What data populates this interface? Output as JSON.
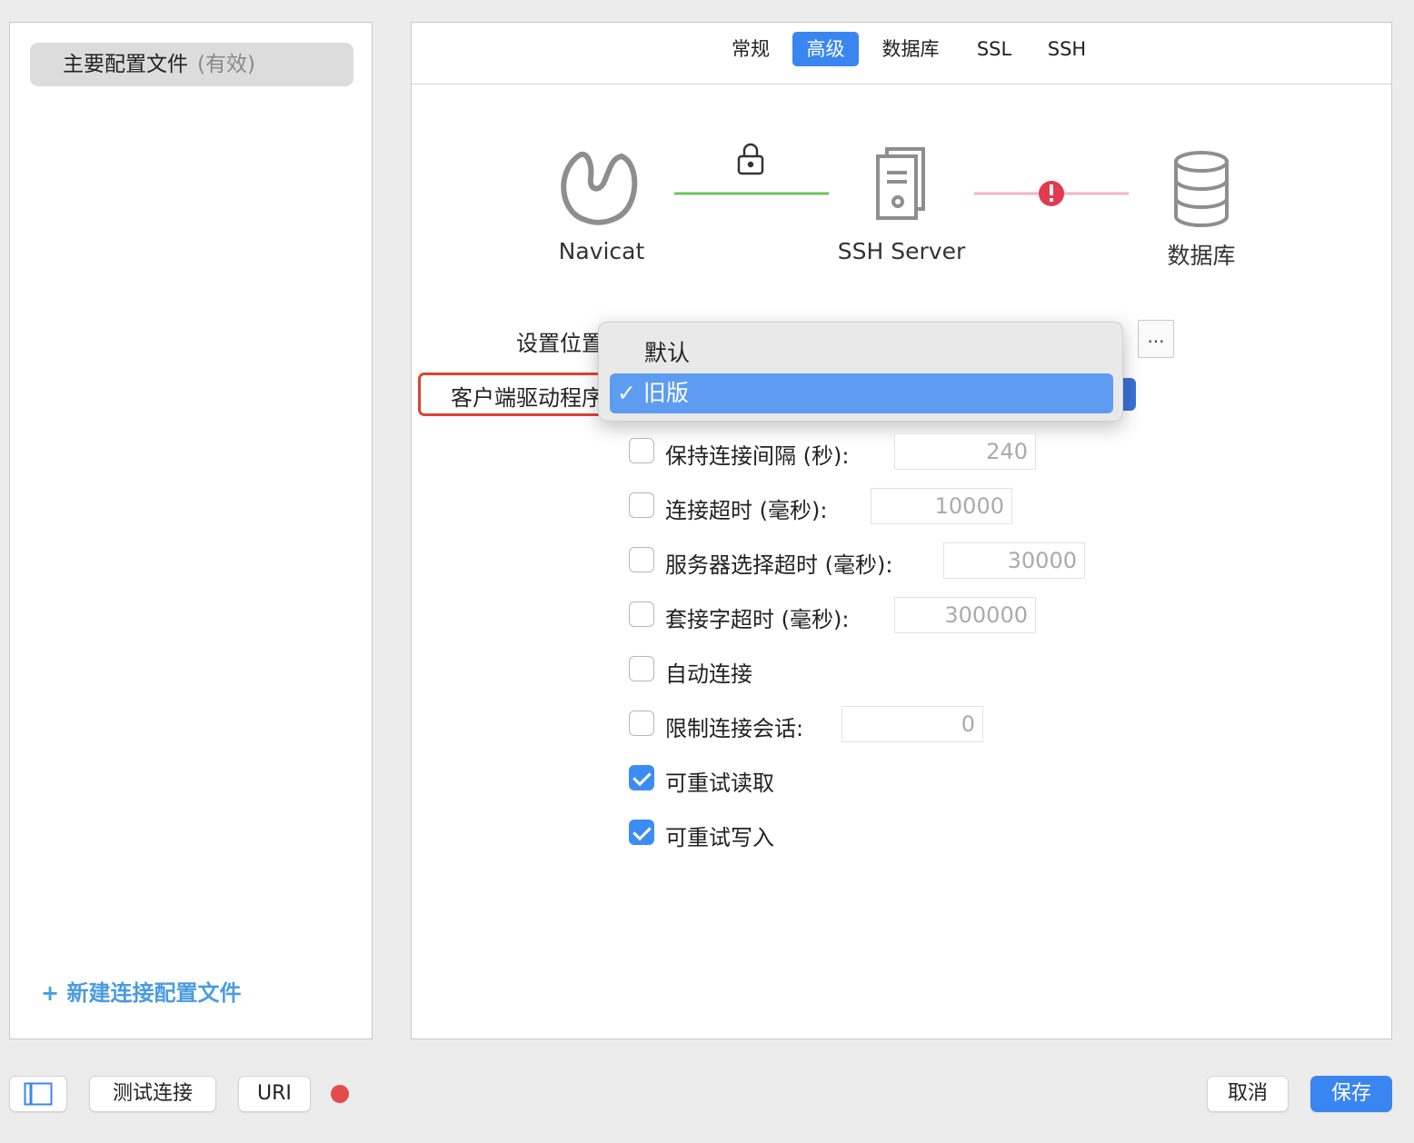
{
  "sidebar": {
    "profile_name": "主要配置文件",
    "profile_state": "(有效)",
    "new_profile": "+ 新建连接配置文件"
  },
  "tabs": [
    {
      "label": "常规",
      "active": false
    },
    {
      "label": "高级",
      "active": true
    },
    {
      "label": "数据库",
      "active": false
    },
    {
      "label": "SSL",
      "active": false
    },
    {
      "label": "SSH",
      "active": false
    }
  ],
  "diagram": {
    "nodes": [
      "Navicat",
      "SSH Server",
      "数据库"
    ],
    "link1_color": "#6cc35a",
    "link2_color": "#f0b5c4",
    "error_color": "#e23a4f"
  },
  "form": {
    "settings_location_label": "设置位置",
    "client_driver_label": "客户端驱动程序",
    "browse_button": "...",
    "dropdown_options": [
      "默认",
      "旧版"
    ],
    "dropdown_selected": "旧版",
    "options": [
      {
        "label": "保持连接间隔 (秒):",
        "checked": false,
        "value": "240"
      },
      {
        "label": "连接超时 (毫秒):",
        "checked": false,
        "value": "10000"
      },
      {
        "label": "服务器选择超时 (毫秒):",
        "checked": false,
        "value": "30000"
      },
      {
        "label": "套接字超时 (毫秒):",
        "checked": false,
        "value": "300000"
      },
      {
        "label": "自动连接",
        "checked": false
      },
      {
        "label": "限制连接会话:",
        "checked": false,
        "value": "0"
      },
      {
        "label": "可重试读取",
        "checked": true
      },
      {
        "label": "可重试写入",
        "checked": true
      }
    ]
  },
  "footer": {
    "test_connection": "测试连接",
    "uri": "URI",
    "cancel": "取消",
    "save": "保存",
    "status_color": "#e24c4b"
  },
  "colors": {
    "accent": "#3a86f0",
    "highlight": "#e0432f"
  }
}
